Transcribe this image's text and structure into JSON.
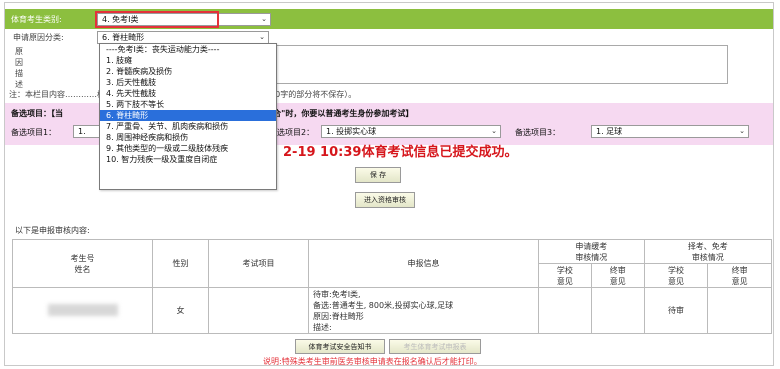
{
  "form": {
    "type_label": "体育考生类别:",
    "type_value": "4. 免考Ⅰ类",
    "reason_label": "申请原因分类:",
    "reason_value": "6. 脊柱畸形",
    "desc_label_chars": [
      "原",
      "因",
      "描",
      "述"
    ],
    "note": "注：本栏目内容…………根据实际情况如实填写，并尽可能详尽（但超出200字的部分将不保存）。",
    "pink_line1_a": "备选项目：【当",
    "pink_line1_b": "最终审核为\"不符合\"时，你要以普通考生身份参加考试】",
    "item1_label": "备选项目1：",
    "item1_value": "1.",
    "item2_label": "备选项目2：",
    "item2_value": "1. 投掷实心球",
    "item3_label": "备选项目3：",
    "item3_value": "1. 足球"
  },
  "dropdown": {
    "items": [
      "----免考Ⅰ类：丧失运动能力类----",
      "1. 肢瘫",
      "2. 脊髓疾病及损伤",
      "3. 后天性截肢",
      "4. 先天性截肢",
      "5. 两下肢不等长",
      "6. 脊柱畸形",
      "7. 严重骨、关节、肌肉疾病和损伤",
      "8. 周围神经疾病和损伤",
      "9. 其他类型的一级或二级肢体残疾",
      "10. 智力残疾一级及重度自闭症"
    ],
    "selected_index": 6
  },
  "success_msg": "2-19 10:39体育考试信息已提交成功。",
  "buttons": {
    "save": "保 存",
    "review": "进入资格审核",
    "safety": "体育考试安全告知书",
    "print": "考生体育考试申报表"
  },
  "list_title": "以下是申报审核内容:",
  "table": {
    "headers": {
      "id_name": "考生号\n姓名",
      "gender": "性别",
      "exam": "考试项目",
      "info": "申报信息",
      "slow_group": "申请缓考\n审核情况",
      "exempt_group": "择考、免考\n审核情况",
      "school1": "学校\n意见",
      "final1": "终审\n意见",
      "school2": "学校\n意见",
      "final2": "终审\n意见"
    },
    "row": {
      "gender": "女",
      "info_lines": [
        "待审:免考Ⅰ类,",
        "备选:普通考生, 800米,投掷实心球,足球",
        "原因:脊柱畸形",
        "描述:"
      ],
      "status": "待审"
    }
  },
  "warning": "说明:特殊类考生审前医务审核申请表在报名确认后才能打印。"
}
